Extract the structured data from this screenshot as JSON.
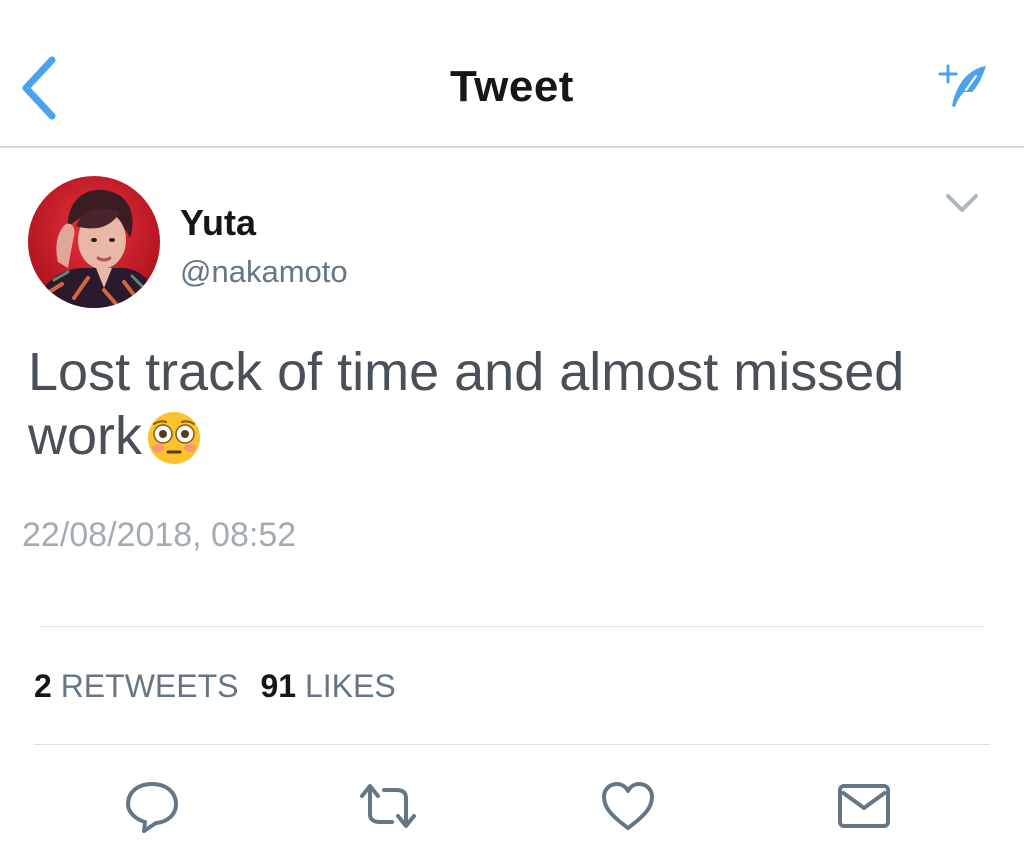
{
  "nav": {
    "title": "Tweet"
  },
  "tweet": {
    "author_name": "Yuta",
    "author_handle": "@nakamoto",
    "text": "Lost track of time and almost missed work",
    "emoji": "😳",
    "timestamp": "22/08/2018, 08:52"
  },
  "stats": {
    "retweets_count": "2",
    "retweets_label": "RETWEETS",
    "likes_count": "91",
    "likes_label": "LIKES"
  },
  "colors": {
    "accent": "#4aa3ec",
    "text_primary": "#14171a",
    "text_secondary": "#657786",
    "text_body": "#4a5057",
    "timestamp": "#a3acb4",
    "divider": "#dfe3e6",
    "action_icon": "#657786"
  },
  "icons": {
    "back": "chevron-left-icon",
    "compose": "compose-feather-icon",
    "menu": "chevron-down-icon",
    "reply": "reply-bubble-icon",
    "retweet": "retweet-icon",
    "like": "heart-icon",
    "dm": "envelope-icon"
  }
}
